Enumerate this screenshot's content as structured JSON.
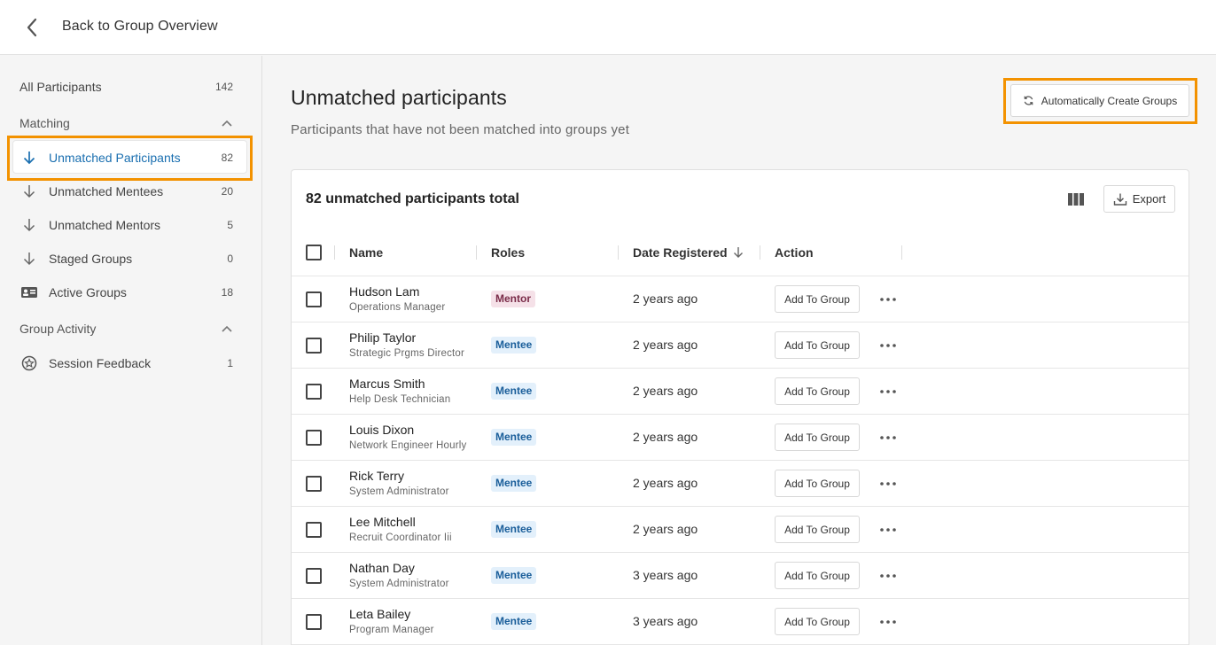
{
  "header": {
    "back_label": "Back to Group Overview"
  },
  "sidebar": {
    "all": {
      "label": "All Participants",
      "count": "142"
    },
    "matching_section": "Matching",
    "matching_items": [
      {
        "label": "Unmatched Participants",
        "count": "82",
        "icon": "arrow-down-icon"
      },
      {
        "label": "Unmatched Mentees",
        "count": "20",
        "icon": "arrow-down-icon"
      },
      {
        "label": "Unmatched Mentors",
        "count": "5",
        "icon": "arrow-down-icon"
      },
      {
        "label": "Staged Groups",
        "count": "0",
        "icon": "arrow-down-icon"
      },
      {
        "label": "Active Groups",
        "count": "18",
        "icon": "id-card-icon"
      }
    ],
    "activity_section": "Group Activity",
    "activity_items": [
      {
        "label": "Session Feedback",
        "count": "1",
        "icon": "feedback-icon"
      }
    ],
    "active_item": "Unmatched Participants"
  },
  "main": {
    "title": "Unmatched participants",
    "subtitle": "Participants that have not been matched into groups yet",
    "auto_button": "Automatically Create Groups",
    "highlight_color": "#f39200",
    "accent_color": "#1a6fb0"
  },
  "table": {
    "total_label": "82 unmatched participants total",
    "export_label": "Export",
    "columns": [
      "Name",
      "Roles",
      "Date Registered",
      "Action"
    ],
    "sorted_column": "Date Registered",
    "sort_direction": "descending",
    "add_button_label": "Add To Group",
    "rows": [
      {
        "name": "Hudson Lam",
        "title": "Operations Manager",
        "role": "Mentor",
        "date": "2 years ago"
      },
      {
        "name": "Philip Taylor",
        "title": "Strategic Prgms Director",
        "role": "Mentee",
        "date": "2 years ago"
      },
      {
        "name": "Marcus Smith",
        "title": "Help Desk Technician",
        "role": "Mentee",
        "date": "2 years ago"
      },
      {
        "name": "Louis Dixon",
        "title": "Network Engineer Hourly",
        "role": "Mentee",
        "date": "2 years ago"
      },
      {
        "name": "Rick Terry",
        "title": "System Administrator",
        "role": "Mentee",
        "date": "2 years ago"
      },
      {
        "name": "Lee Mitchell",
        "title": "Recruit Coordinator Iii",
        "role": "Mentee",
        "date": "2 years ago"
      },
      {
        "name": "Nathan Day",
        "title": "System Administrator",
        "role": "Mentee",
        "date": "3 years ago"
      },
      {
        "name": "Leta Bailey",
        "title": "Program Manager",
        "role": "Mentee",
        "date": "3 years ago"
      }
    ]
  }
}
